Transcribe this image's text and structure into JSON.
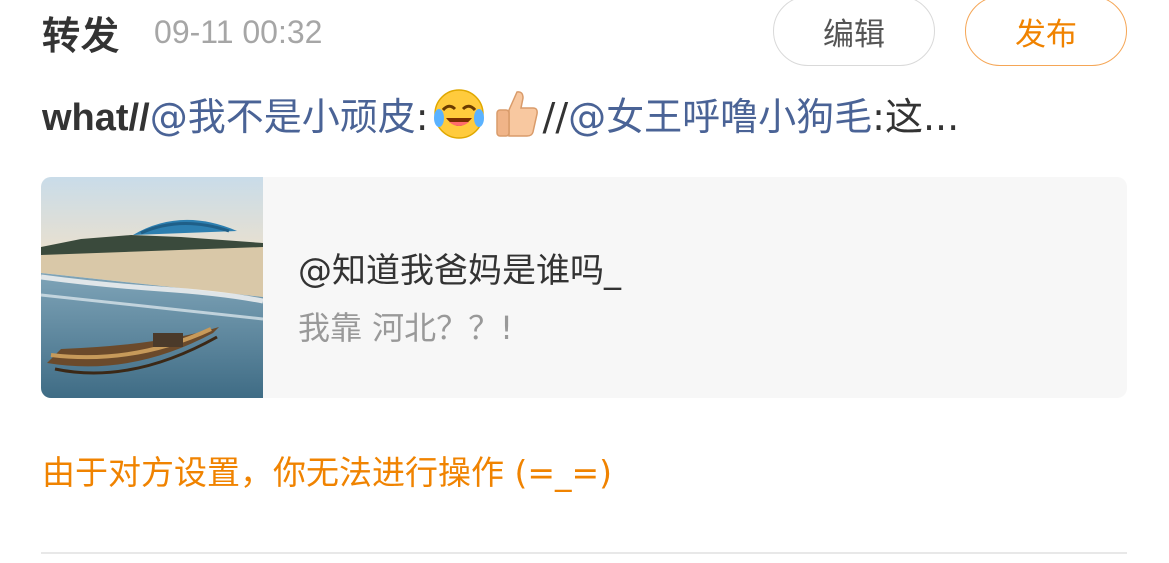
{
  "header": {
    "title": "转发",
    "timestamp": "09-11 00:32"
  },
  "buttons": {
    "edit_label": "编辑",
    "publish_label": "发布"
  },
  "repost_line": {
    "prefix": "what//",
    "mention1": "@我不是小顽皮",
    "colon1": ":",
    "emoji1": "laughing-crying-icon",
    "emoji2": "thumbs-up-icon",
    "sep2": "//",
    "mention2": "@女王呼噜小狗毛",
    "tail": ":这..."
  },
  "card": {
    "image": "beach-boat-photo",
    "user": "@知道我爸妈是谁吗_",
    "text": "我靠 河北？？!"
  },
  "notice": {
    "text": "由于对方设置，你无法进行操作 (=_=)"
  },
  "colors": {
    "accent": "#f08300",
    "mention": "#4a6396",
    "muted": "#a6a6a6"
  }
}
